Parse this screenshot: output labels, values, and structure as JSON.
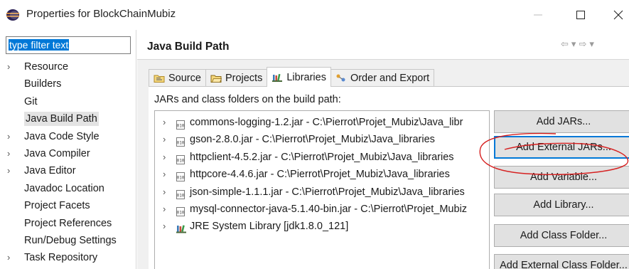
{
  "window": {
    "title": "Properties for BlockChainMubiz",
    "minimize_glyph": "—",
    "maximize_glyph": "☐",
    "close_glyph": "✕"
  },
  "sidebar": {
    "filter_value": "type filter text",
    "items": [
      {
        "label": "Resource",
        "expandable": true
      },
      {
        "label": "Builders",
        "expandable": false
      },
      {
        "label": "Git",
        "expandable": false
      },
      {
        "label": "Java Build Path",
        "expandable": false,
        "selected": true
      },
      {
        "label": "Java Code Style",
        "expandable": true
      },
      {
        "label": "Java Compiler",
        "expandable": true
      },
      {
        "label": "Java Editor",
        "expandable": true
      },
      {
        "label": "Javadoc Location",
        "expandable": false
      },
      {
        "label": "Project Facets",
        "expandable": false
      },
      {
        "label": "Project References",
        "expandable": false
      },
      {
        "label": "Run/Debug Settings",
        "expandable": false
      },
      {
        "label": "Task Repository",
        "expandable": true
      }
    ]
  },
  "page": {
    "title": "Java Build Path",
    "tabs": [
      {
        "label": "Source",
        "icon": "source-folder-icon"
      },
      {
        "label": "Projects",
        "icon": "project-folder-icon"
      },
      {
        "label": "Libraries",
        "icon": "libraries-icon",
        "active": true
      },
      {
        "label": "Order and Export",
        "icon": "order-export-icon"
      }
    ],
    "section_label": "JARs and class folders on the build path:",
    "entries": [
      {
        "text": "commons-logging-1.2.jar - C:\\Pierrot\\Projet_Mubiz\\Java_libr",
        "icon": "jar-icon"
      },
      {
        "text": "gson-2.8.0.jar - C:\\Pierrot\\Projet_Mubiz\\Java_libraries",
        "icon": "jar-icon"
      },
      {
        "text": "httpclient-4.5.2.jar - C:\\Pierrot\\Projet_Mubiz\\Java_libraries",
        "icon": "jar-icon"
      },
      {
        "text": "httpcore-4.4.6.jar - C:\\Pierrot\\Projet_Mubiz\\Java_libraries",
        "icon": "jar-icon"
      },
      {
        "text": "json-simple-1.1.1.jar - C:\\Pierrot\\Projet_Mubiz\\Java_libraries",
        "icon": "jar-icon"
      },
      {
        "text": "mysql-connector-java-5.1.40-bin.jar - C:\\Pierrot\\Projet_Mubiz",
        "icon": "jar-icon"
      },
      {
        "text": "JRE System Library [jdk1.8.0_121]",
        "icon": "library-icon"
      }
    ],
    "buttons": [
      {
        "label": "Add JARs..."
      },
      {
        "label": "Add External JARs...",
        "focused": true
      },
      {
        "label": "Add Variable..."
      },
      {
        "label": "Add Library..."
      },
      {
        "label": "Add Class Folder..."
      },
      {
        "label": "Add External Class Folder..."
      }
    ]
  },
  "colors": {
    "selection": "#0078d7",
    "annotation": "#d62020"
  }
}
